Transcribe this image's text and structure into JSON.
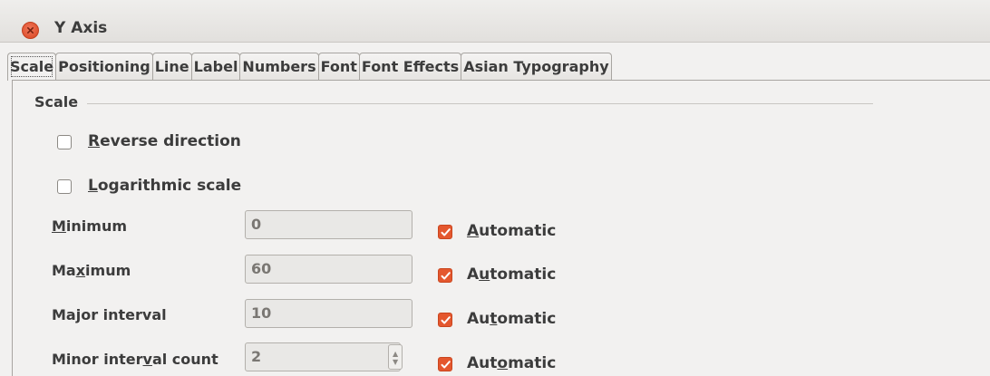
{
  "window": {
    "title": "Y Axis"
  },
  "tabs": [
    "Scale",
    "Positioning",
    "Line",
    "Label",
    "Numbers",
    "Font",
    "Font Effects",
    "Asian Typography"
  ],
  "scale": {
    "section_title": "Scale",
    "reverse_direction": {
      "label": "Reverse direction",
      "checked": false
    },
    "logarithmic_scale": {
      "label": "Logarithmic scale",
      "checked": false
    },
    "rows": [
      {
        "label": "Minimum",
        "value": "0",
        "automatic_label": "Automatic",
        "automatic_checked": true
      },
      {
        "label": "Maximum",
        "value": "60",
        "automatic_label": "Automatic",
        "automatic_checked": true
      },
      {
        "label": "Major interval",
        "value": "10",
        "automatic_label": "Automatic",
        "automatic_checked": true
      },
      {
        "label": "Minor interval count",
        "value": "2",
        "automatic_label": "Automatic",
        "automatic_checked": true
      }
    ]
  },
  "colors": {
    "accent": "#e4572e",
    "close": "#e0522f"
  }
}
